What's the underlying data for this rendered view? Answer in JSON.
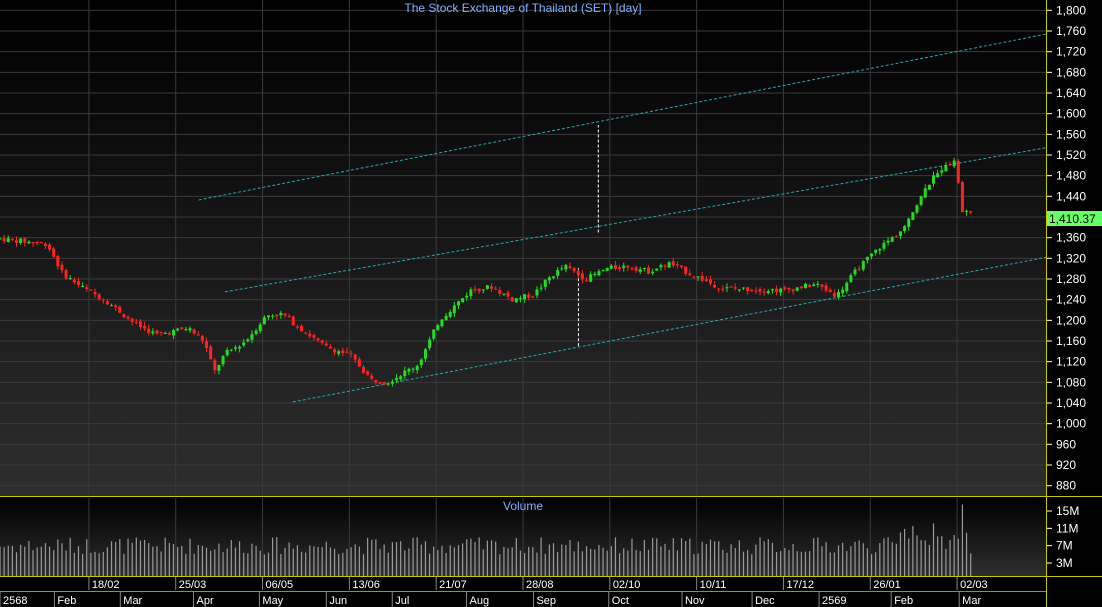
{
  "title": "The Stock Exchange of Thailand (SET) [day]",
  "last_price_label": "1,410.37",
  "volume_panel_title": "Volume",
  "colors": {
    "background": "#000000",
    "grid": "#3a3a3a",
    "up_candle": "#22dd22",
    "down_candle": "#ff2222",
    "channel_line": "#2aa7b4",
    "volume_bar": "#9a9a9a",
    "title_text": "#7fb2ff",
    "axis_text": "#ffffff",
    "panel_border": "#c8c800",
    "price_label_bg": "#66ff66"
  },
  "chart_data": [
    {
      "type": "candlestick",
      "title": "The Stock Exchange of Thailand (SET) [day]",
      "ylim": [
        860,
        1820
      ],
      "y_ticks": [
        "1,800",
        "1,760",
        "1,720",
        "1,680",
        "1,640",
        "1,600",
        "1,560",
        "1,520",
        "1,480",
        "1,440",
        "1,400",
        "1,360",
        "1,320",
        "1,280",
        "1,240",
        "1,200",
        "1,160",
        "1,120",
        "1,080",
        "1,040",
        "1,000",
        "960",
        "920",
        "880"
      ],
      "y_tick_values": [
        1800,
        1760,
        1720,
        1680,
        1640,
        1600,
        1560,
        1520,
        1480,
        1440,
        1400,
        1360,
        1320,
        1280,
        1240,
        1200,
        1160,
        1120,
        1080,
        1040,
        1000,
        960,
        920,
        880
      ],
      "date_labels": [
        "18/02",
        "25/03",
        "06/05",
        "13/06",
        "21/07",
        "28/08",
        "02/10",
        "10/11",
        "17/12",
        "26/01",
        "02/03"
      ],
      "month_labels": [
        "2568",
        "Feb",
        "Mar",
        "Apr",
        "May",
        "Jun",
        "Jul",
        "Aug",
        "Sep",
        "Oct",
        "Nov",
        "Dec",
        "2569",
        "Feb",
        "Mar"
      ],
      "last_price": 1410.37,
      "trend_channel": {
        "lower_start": [
          0.28,
          1042
        ],
        "lower_end": [
          1.0,
          1322
        ],
        "middle_start": [
          0.215,
          1255
        ],
        "middle_end": [
          1.0,
          1534
        ],
        "upper_start": [
          0.19,
          1433
        ],
        "upper_end": [
          1.0,
          1754
        ]
      },
      "price_anchors": [
        [
          0.0,
          1358
        ],
        [
          0.045,
          1348
        ],
        [
          0.06,
          1290
        ],
        [
          0.08,
          1262
        ],
        [
          0.1,
          1240
        ],
        [
          0.13,
          1192
        ],
        [
          0.15,
          1172
        ],
        [
          0.18,
          1185
        ],
        [
          0.195,
          1160
        ],
        [
          0.205,
          1100
        ],
        [
          0.215,
          1135
        ],
        [
          0.235,
          1160
        ],
        [
          0.255,
          1210
        ],
        [
          0.27,
          1212
        ],
        [
          0.29,
          1180
        ],
        [
          0.31,
          1150
        ],
        [
          0.335,
          1132
        ],
        [
          0.355,
          1085
        ],
        [
          0.37,
          1080
        ],
        [
          0.4,
          1115
        ],
        [
          0.42,
          1200
        ],
        [
          0.45,
          1258
        ],
        [
          0.47,
          1265
        ],
        [
          0.49,
          1240
        ],
        [
          0.51,
          1250
        ],
        [
          0.525,
          1282
        ],
        [
          0.54,
          1305
        ],
        [
          0.56,
          1280
        ],
        [
          0.58,
          1300
        ],
        [
          0.6,
          1305
        ],
        [
          0.62,
          1295
        ],
        [
          0.64,
          1310
        ],
        [
          0.66,
          1290
        ],
        [
          0.69,
          1262
        ],
        [
          0.72,
          1260
        ],
        [
          0.75,
          1258
        ],
        [
          0.78,
          1270
        ],
        [
          0.8,
          1248
        ],
        [
          0.82,
          1300
        ],
        [
          0.84,
          1340
        ],
        [
          0.86,
          1370
        ],
        [
          0.875,
          1420
        ],
        [
          0.89,
          1470
        ],
        [
          0.905,
          1505
        ],
        [
          0.915,
          1505
        ],
        [
          0.918,
          1410
        ],
        [
          0.93,
          1410
        ]
      ]
    },
    {
      "type": "bar",
      "title": "Volume",
      "y_ticks": [
        "15M",
        "11M",
        "7M",
        "3M"
      ],
      "y_tick_values": [
        15,
        11,
        7,
        3
      ]
    }
  ]
}
